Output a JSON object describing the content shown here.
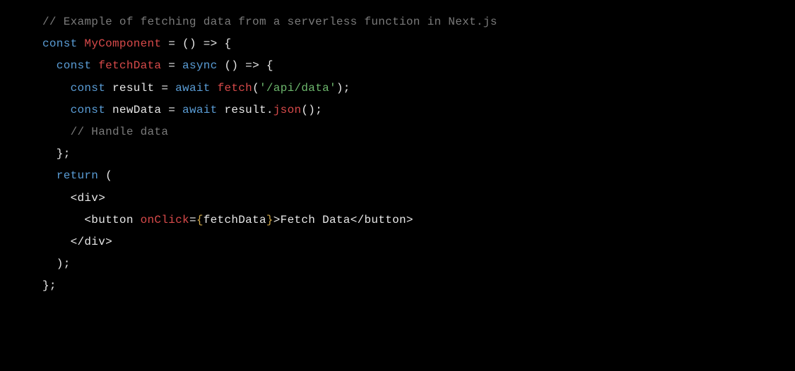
{
  "code": {
    "l1_comment": "// Example of fetching data from a serverless function in Next.js",
    "l2_const": "const",
    "l2_name": " MyComponent",
    "l2_rest": " = () => {",
    "l3_const": "  const",
    "l3_name": " fetchData",
    "l3_eq": " = ",
    "l3_async": "async",
    "l3_rest": " () => {",
    "l4_const": "    const",
    "l4_var": " result = ",
    "l4_await": "await",
    "l4_sp": " ",
    "l4_fetch": "fetch",
    "l4_paren_open": "(",
    "l4_str": "'/api/data'",
    "l4_paren_close": ");",
    "l5_const": "    const",
    "l5_var": " newData = ",
    "l5_await": "await",
    "l5_mid": " result.",
    "l5_json": "json",
    "l5_end": "();",
    "l6_comment": "    // Handle data",
    "l7": "  };",
    "l8": "",
    "l9_return": "  return",
    "l9_paren": " (",
    "l10": "    <div>",
    "l11_open": "      <button ",
    "l11_attr": "onClick",
    "l11_eq": "=",
    "l11_brace_open": "{",
    "l11_val": "fetchData",
    "l11_brace_close": "}",
    "l11_rest": ">Fetch Data</button>",
    "l12": "    </div>",
    "l13": "  );",
    "l14": "};"
  }
}
